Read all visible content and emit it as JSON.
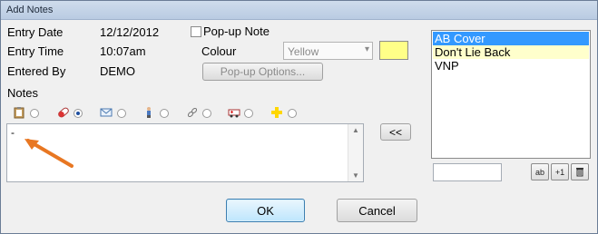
{
  "window": {
    "title": "Add Notes"
  },
  "form": {
    "entry_date_label": "Entry Date",
    "entry_date_value": "12/12/2012",
    "entry_time_label": "Entry Time",
    "entry_time_value": "10:07am",
    "entered_by_label": "Entered By",
    "entered_by_value": "DEMO",
    "notes_label": "Notes"
  },
  "popup": {
    "checkbox_label": "Pop-up Note",
    "checked": false,
    "colour_label": "Colour",
    "colour_value": "Yellow",
    "colour_swatch": "#ffff88",
    "options_button": "Pop-up Options..."
  },
  "note_types": [
    {
      "icon": "clipboard-icon",
      "selected": false
    },
    {
      "icon": "pill-icon",
      "selected": true
    },
    {
      "icon": "envelope-icon",
      "selected": false
    },
    {
      "icon": "person-icon",
      "selected": false
    },
    {
      "icon": "link-icon",
      "selected": false
    },
    {
      "icon": "ambulance-icon",
      "selected": false
    },
    {
      "icon": "cross-icon",
      "selected": false
    }
  ],
  "notes_text": "-",
  "move_button": "<<",
  "list": {
    "items": [
      {
        "label": "AB Cover",
        "state": "selected"
      },
      {
        "label": "Don't Lie Back",
        "state": "highlighted"
      },
      {
        "label": "VNP",
        "state": "normal"
      }
    ],
    "selected_color": "#3399ff",
    "highlight_color": "#ffffcc",
    "edit_button": "ab",
    "add_button": "+1"
  },
  "buttons": {
    "ok": "OK",
    "cancel": "Cancel"
  },
  "annotation": {
    "arrow_color": "#e87722"
  }
}
